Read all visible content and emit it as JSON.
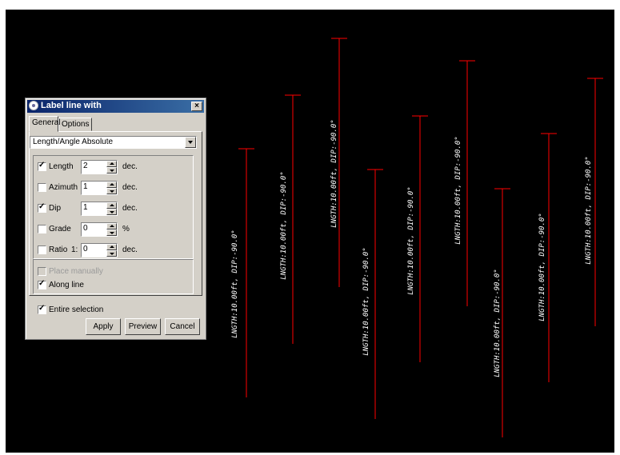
{
  "dialog": {
    "title": "Label line with",
    "close": "×",
    "tabs": [
      "General",
      "Options"
    ],
    "select_value": "Length/Angle Absolute",
    "rows": [
      {
        "label": "Length",
        "checked": true,
        "value": "2",
        "unit": "dec."
      },
      {
        "label": "Azimuth",
        "checked": false,
        "value": "1",
        "unit": "dec."
      },
      {
        "label": "Dip",
        "checked": true,
        "value": "1",
        "unit": "dec."
      },
      {
        "label": "Grade",
        "checked": false,
        "value": "0",
        "unit": "%"
      },
      {
        "label": "Ratio",
        "ratio_prefix": "1:",
        "checked": false,
        "value": "0",
        "unit": "dec."
      }
    ],
    "place_manually": "Place manually",
    "along_line": "Along line",
    "entire_selection": "Entire selection",
    "buttons": {
      "apply": "Apply",
      "preview": "Preview",
      "cancel": "Cancel"
    }
  },
  "scene": {
    "line_color": "#ff0000",
    "label_color": "#ffffff",
    "background": "#000000",
    "label_text": "LNGTH:10.00ft, DIP:-90.0°"
  }
}
